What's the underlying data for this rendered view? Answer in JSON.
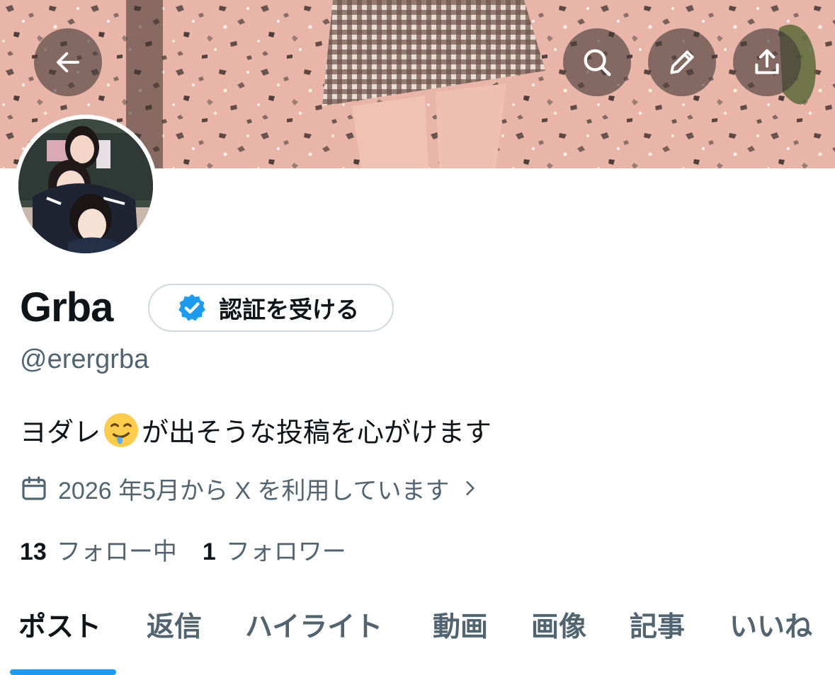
{
  "profile": {
    "name": "Grba",
    "handle": "@erergrba",
    "verify_button_label": "認証を受ける",
    "bio_before": "ヨダレ",
    "bio_emoji": "drooling-face-emoji",
    "bio_after": "が出そうな投稿を心がけます",
    "joined": "2026 年5月から X を利用しています",
    "following_count": "13",
    "following_label": "フォロー中",
    "followers_count": "1",
    "followers_label": "フォロワー"
  },
  "header_buttons": {
    "back": "back-arrow-icon",
    "search": "search-icon",
    "edit": "pencil-icon",
    "share": "share-icon"
  },
  "tabs": [
    {
      "label": "ポスト",
      "active": true
    },
    {
      "label": "返信",
      "active": false
    },
    {
      "label": "ハイライト",
      "active": false
    },
    {
      "label": "動画",
      "active": false
    },
    {
      "label": "画像",
      "active": false
    },
    {
      "label": "記事",
      "active": false
    },
    {
      "label": "いいね",
      "active": false
    }
  ],
  "colors": {
    "accent": "#1d9bf0",
    "text_primary": "#0f1419",
    "text_secondary": "#536471",
    "border": "#cfd9de"
  }
}
